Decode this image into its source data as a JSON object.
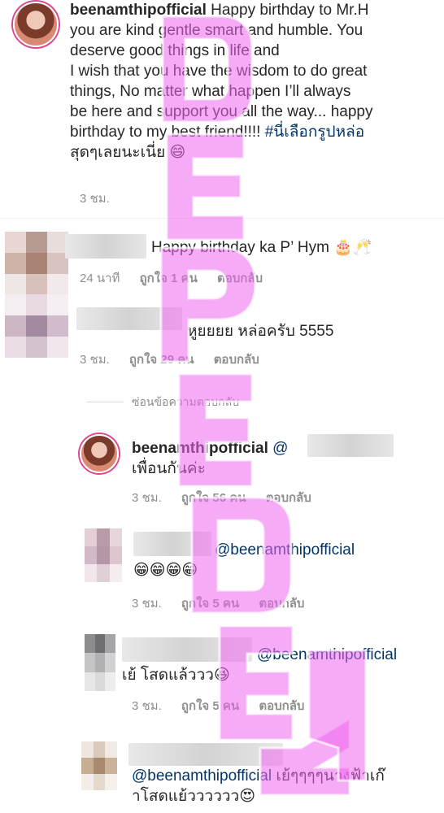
{
  "caption": {
    "username": "beenamthipofficial",
    "text_lines": [
      "Happy birthday to Mr.H",
      "you are kind gentle smart and humble. You",
      "deserve good things in life and",
      "I wish that you have the wisdom to do great",
      "things, No matter what happen I’ll always",
      "be here and support you all the way... happy",
      "birthday to my best friend!!!! "
    ],
    "hashtag": "#นี่เลือกรูปหล่อ",
    "last_line": "สุดๆเลยนะเนี่ย 😄",
    "time": "3 ชม."
  },
  "comments": [
    {
      "text": "Happy birthday ka P’ Hym 🎂🥂",
      "time": "24 นาที",
      "likes": "ถูกใจ 1 คน",
      "reply": "ตอบกลับ"
    },
    {
      "text": "หูยยยย หล่อครับ 5555",
      "time": "3 ชม.",
      "likes": "ถูกใจ 29 คน",
      "reply": "ตอบกลับ"
    }
  ],
  "hide_replies": "ซ่อนข้อความตอบกลับ",
  "replies": [
    {
      "username": "beenamthipofficial",
      "mention": "@",
      "text": "เพื่อนกันค่ะ",
      "time": "3 ชม.",
      "likes": "ถูกใจ 56 คน",
      "reply": "ตอบกลับ"
    },
    {
      "mention": "@beenamthipofficial",
      "text": "😁😁😁😁",
      "time": "3 ชม.",
      "likes": "ถูกใจ 5 คน",
      "reply": "ตอบกลับ"
    },
    {
      "mention": "@beenamthipofficial",
      "text": "เย้ โสดแล้ววว😆",
      "time": "3 ชม.",
      "likes": "ถูกใจ 5 คน",
      "reply": "ตอบกลับ"
    },
    {
      "mention": "@beenamthipofficial",
      "text_line1": "เย้ๆๆๆๆนางฟ้าเก๊",
      "text_line2": "าโสดแย้วววววว😍"
    }
  ],
  "colors": {
    "mention": "#003569",
    "meta": "#8e8e8e",
    "watermark": "#ee66ee"
  }
}
